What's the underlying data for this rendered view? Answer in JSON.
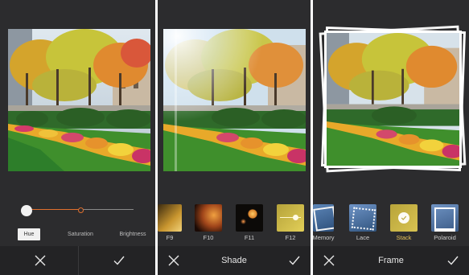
{
  "panel_adjust": {
    "tabs": [
      {
        "label": "Hue",
        "active": true
      },
      {
        "label": "Saturation",
        "active": false
      },
      {
        "label": "Brightness",
        "active": false
      }
    ],
    "hue_slider_level": 0,
    "accent_color": "#e0702e"
  },
  "panel_shade": {
    "title": "Shade",
    "filters": [
      {
        "label": "F9",
        "icon": "gold-gradient-icon"
      },
      {
        "label": "F10",
        "icon": "orange-glow-icon"
      },
      {
        "label": "F11",
        "icon": "bokeh-lights-icon"
      },
      {
        "label": "F12",
        "icon": "yellow-slider-icon"
      }
    ]
  },
  "panel_frame": {
    "title": "Frame",
    "frames": [
      {
        "label": "Memory",
        "active": false
      },
      {
        "label": "Lace",
        "active": false
      },
      {
        "label": "Stack",
        "active": true
      },
      {
        "label": "Polaroid",
        "active": false
      }
    ],
    "active_color": "#e9c45a"
  },
  "actions": {
    "cancel_icon": "close-icon",
    "confirm_icon": "check-icon"
  }
}
